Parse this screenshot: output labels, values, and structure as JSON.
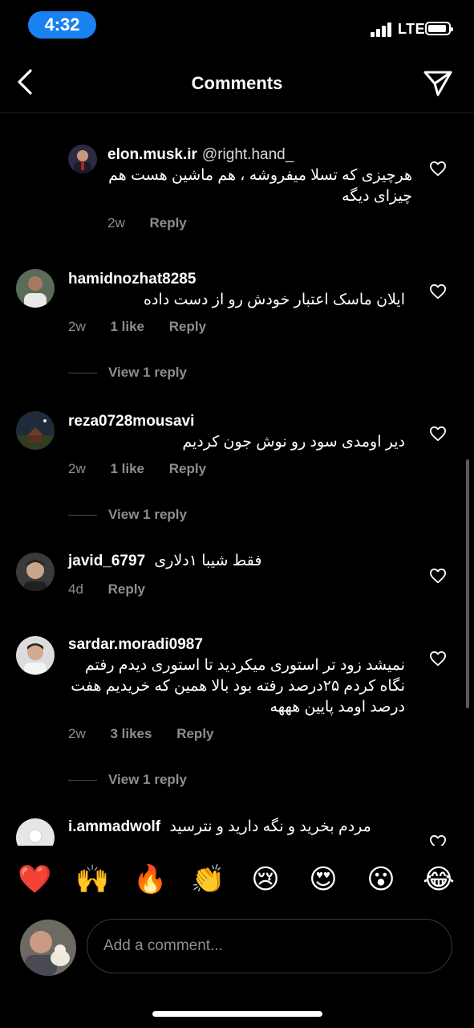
{
  "status_bar": {
    "time": "4:32",
    "network": "LTE"
  },
  "header": {
    "title": "Comments",
    "back_icon": "chevron-left-icon",
    "send_icon": "paper-plane-icon"
  },
  "comments": [
    {
      "username": "elon.musk.ir",
      "mention": "@right.hand_",
      "text": "هرچیزی که تسلا میفروشه ، هم ماشین هست هم چیزای دیگه",
      "age": "2w",
      "reply_label": "Reply"
    },
    {
      "username": "hamidnozhat8285",
      "text": "ایلان ماسک اعتبار خودش رو از دست داده",
      "age": "2w",
      "likes": "1 like",
      "reply_label": "Reply",
      "view_replies": "View 1 reply"
    },
    {
      "username": "reza0728mousavi",
      "text": "دیر اومدی سود رو نوش جون کردیم",
      "age": "2w",
      "likes": "1 like",
      "reply_label": "Reply",
      "view_replies": "View 1 reply"
    },
    {
      "username": "javid_6797",
      "text": "فقط شیبا ۱دلاری",
      "age": "4d",
      "reply_label": "Reply"
    },
    {
      "username": "sardar.moradi0987",
      "text": "نمیشد زود تر استوری میکردید تا استوری دیدم رفتم نگاه کردم ۲۵درصد رفته بود بالا همین که خریدیم هفت درصد اومد پایین هههه",
      "age": "2w",
      "likes": "3 likes",
      "reply_label": "Reply",
      "view_replies": "View 1 reply"
    },
    {
      "username": "i.ammadwolf",
      "text": "مردم بخرید و نگه دارید و نترسید"
    }
  ],
  "emoji_bar": [
    "❤️",
    "🙌",
    "🔥",
    "👏",
    "😢",
    "😍",
    "😮",
    "😂"
  ],
  "composer": {
    "placeholder": "Add a comment..."
  },
  "colors": {
    "background": "#000000",
    "time_pill": "#1a82f0",
    "secondary_text": "#8e8e8e"
  }
}
